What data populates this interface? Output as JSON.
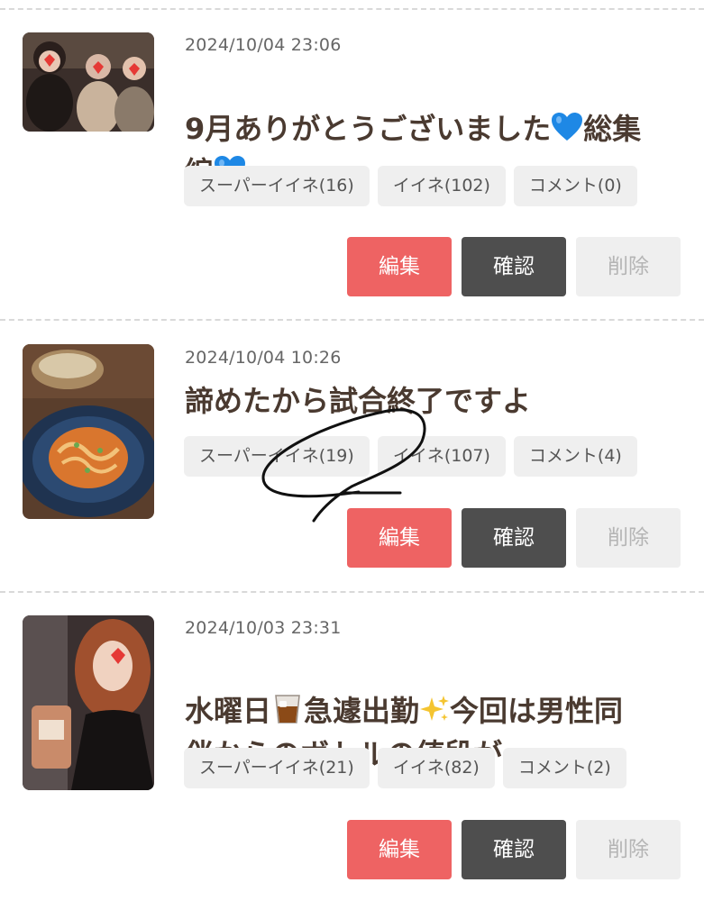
{
  "posts": [
    {
      "date": "2024/10/04 23:06",
      "title_line1_a": "9月ありがとうございました",
      "title_line1_b": "総集",
      "title_line2_a": "編",
      "chips": [
        "スーパーイイネ(16)",
        "イイネ(102)",
        "コメント(0)"
      ],
      "thumb_icon": "group-photo-icon"
    },
    {
      "date": "2024/10/04 10:26",
      "title": "諦めたから試合終了ですよ",
      "chips": [
        "スーパーイイネ(19)",
        "イイネ(107)",
        "コメント(4)"
      ],
      "thumb_icon": "pasta-photo-icon"
    },
    {
      "date": "2024/10/03 23:31",
      "title_line1_a": "水曜日",
      "title_line1_b": "急遽出勤",
      "title_line1_c": "今回は男性同",
      "title_line2": "伴からのボトルの値段が…………",
      "chips": [
        "スーパーイイネ(21)",
        "イイネ(82)",
        "コメント(2)"
      ],
      "thumb_icon": "portrait-photo-icon"
    }
  ],
  "buttons": {
    "edit": "編集",
    "check": "確認",
    "delete": "削除"
  },
  "colors": {
    "edit": "#ee6363",
    "check": "#4e4e4e",
    "delete": "#efefef",
    "title": "#4a3a30",
    "heart": "#1e88e5"
  },
  "icons": {
    "blue_heart": "blue-heart-icon",
    "whisky": "whisky-glass-icon",
    "sparkles": "sparkles-icon",
    "scribble": "pen-scribble-mark"
  }
}
